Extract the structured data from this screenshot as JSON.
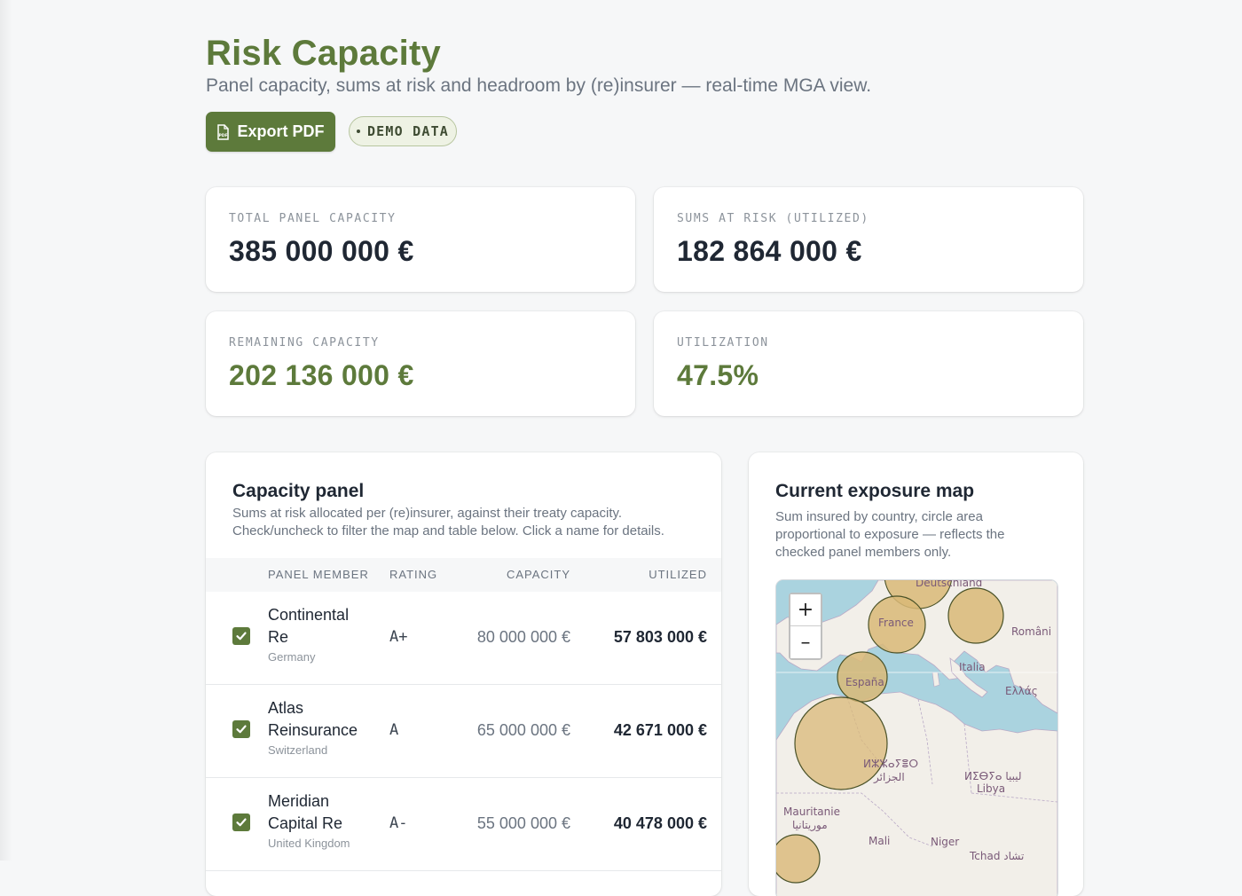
{
  "header": {
    "title": "Risk Capacity",
    "subtitle": "Panel capacity, sums at risk and headroom by (re)insurer — real-time MGA view.",
    "export_label": "Export PDF",
    "export_icon": "pdf-file-icon",
    "demo_badge": "DEMO DATA"
  },
  "kpis": [
    {
      "label": "TOTAL PANEL CAPACITY",
      "value": "385 000 000 €"
    },
    {
      "label": "SUMS AT RISK (UTILIZED)",
      "value": "182 864 000 €"
    },
    {
      "label": "REMAINING CAPACITY",
      "value": "202 136 000 €"
    },
    {
      "label": "UTILIZATION",
      "value": "47.5%"
    }
  ],
  "panel": {
    "title": "Capacity panel",
    "description": "Sums at risk allocated per (re)insurer, against their treaty capacity. Check/uncheck to filter the map and table below. Click a name for details.",
    "columns": {
      "member": "PANEL MEMBER",
      "rating": "RATING",
      "capacity": "CAPACITY",
      "utilized": "UTILIZED"
    },
    "rows": [
      {
        "name": "Continental Re",
        "country": "Germany",
        "rating": "A+",
        "capacity": "80 000 000 €",
        "utilized": "57 803 000 €",
        "checked": true
      },
      {
        "name": "Atlas Reinsurance",
        "country": "Switzerland",
        "rating": "A",
        "capacity": "65 000 000 €",
        "utilized": "42 671 000 €",
        "checked": true
      },
      {
        "name": "Meridian Capital Re",
        "country": "United Kingdom",
        "rating": "A-",
        "capacity": "55 000 000 €",
        "utilized": "40 478 000 €",
        "checked": true
      }
    ]
  },
  "map": {
    "title": "Current exposure map",
    "description": "Sum insured by country, circle area proportional to exposure — reflects the checked panel members only.",
    "zoom_in": "+",
    "zoom_out": "–",
    "labels": {
      "deutschland": "Deutschland",
      "france": "France",
      "romania": "Români",
      "italia": "Italia",
      "espana": "España",
      "ellas": "Ελλάς",
      "algeria": "ⵍⵣⵣⴰⵢⴻⵔ",
      "algeria_ar": "الجزائر",
      "libya": "ⵍⵉⴱⵢⴰ ليبيا",
      "libya_en": "Libya",
      "mauritanie": "Mauritanie",
      "mauritanie_ar": "موريتانيا",
      "mali": "Mali",
      "niger": "Niger",
      "tchad": "Tchad تشاد"
    }
  },
  "colors": {
    "accent": "#5d7a3b",
    "bubble_fill": "#d9b877",
    "bubble_stroke": "#4a5228",
    "sea": "#aad3df",
    "land": "#f2efe9"
  }
}
